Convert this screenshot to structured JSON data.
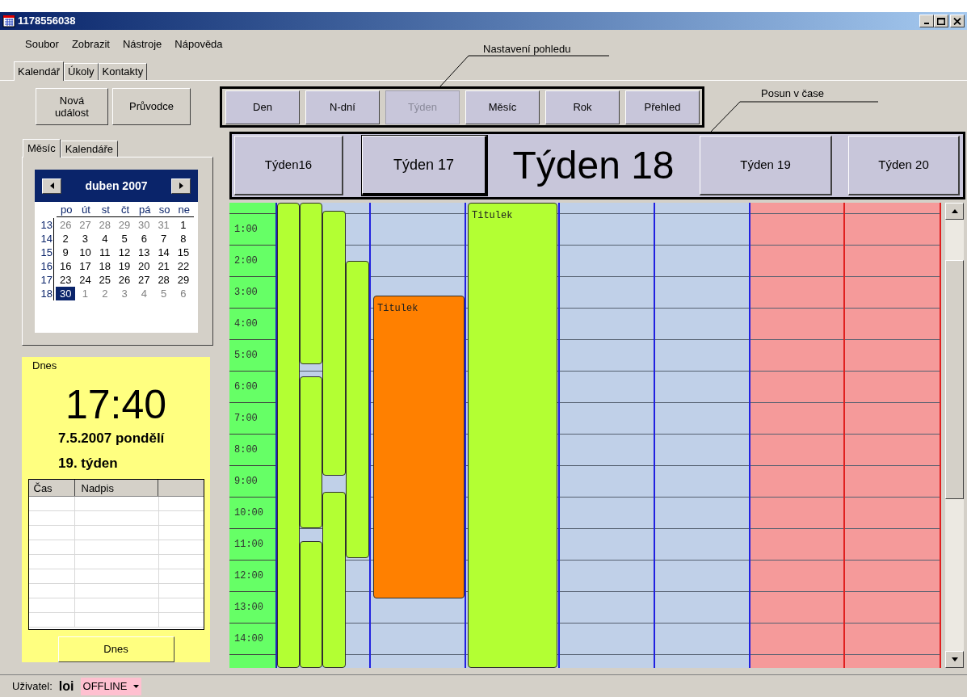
{
  "window": {
    "title": "1178556038"
  },
  "menu": [
    "Soubor",
    "Zobrazit",
    "Nástroje",
    "Nápověda"
  ],
  "tabs": [
    {
      "label": "Kalendář",
      "selected": true
    },
    {
      "label": "Úkoly",
      "selected": false
    },
    {
      "label": "Kontakty",
      "selected": false
    }
  ],
  "actions": [
    "Nová událost",
    "Průvodce"
  ],
  "subtabs": [
    {
      "label": "Měsíc",
      "selected": true
    },
    {
      "label": "Kalendáře",
      "selected": false
    }
  ],
  "mini_calendar": {
    "month": "duben 2007",
    "weekdays": [
      "po",
      "út",
      "st",
      "čt",
      "pá",
      "so",
      "ne"
    ],
    "weeks": [
      {
        "week": "13",
        "days": [
          {
            "label": "26",
            "muted": true,
            "selected": false
          },
          {
            "label": "27",
            "muted": true,
            "selected": false
          },
          {
            "label": "28",
            "muted": true,
            "selected": false
          },
          {
            "label": "29",
            "muted": true,
            "selected": false
          },
          {
            "label": "30",
            "muted": true,
            "selected": false
          },
          {
            "label": "31",
            "muted": true,
            "selected": false
          },
          {
            "label": "1",
            "muted": false,
            "selected": false
          }
        ]
      },
      {
        "week": "14",
        "days": [
          {
            "label": "2",
            "muted": false,
            "selected": false
          },
          {
            "label": "3",
            "muted": false,
            "selected": false
          },
          {
            "label": "4",
            "muted": false,
            "selected": false
          },
          {
            "label": "5",
            "muted": false,
            "selected": false
          },
          {
            "label": "6",
            "muted": false,
            "selected": false
          },
          {
            "label": "7",
            "muted": false,
            "selected": false
          },
          {
            "label": "8",
            "muted": false,
            "selected": false
          }
        ]
      },
      {
        "week": "15",
        "days": [
          {
            "label": "9",
            "muted": false,
            "selected": false
          },
          {
            "label": "10",
            "muted": false,
            "selected": false
          },
          {
            "label": "11",
            "muted": false,
            "selected": false
          },
          {
            "label": "12",
            "muted": false,
            "selected": false
          },
          {
            "label": "13",
            "muted": false,
            "selected": false
          },
          {
            "label": "14",
            "muted": false,
            "selected": false
          },
          {
            "label": "15",
            "muted": false,
            "selected": false
          }
        ]
      },
      {
        "week": "16",
        "days": [
          {
            "label": "16",
            "muted": false,
            "selected": false
          },
          {
            "label": "17",
            "muted": false,
            "selected": false
          },
          {
            "label": "18",
            "muted": false,
            "selected": false
          },
          {
            "label": "19",
            "muted": false,
            "selected": false
          },
          {
            "label": "20",
            "muted": false,
            "selected": false
          },
          {
            "label": "21",
            "muted": false,
            "selected": false
          },
          {
            "label": "22",
            "muted": false,
            "selected": false
          }
        ]
      },
      {
        "week": "17",
        "days": [
          {
            "label": "23",
            "muted": false,
            "selected": false
          },
          {
            "label": "24",
            "muted": false,
            "selected": false
          },
          {
            "label": "25",
            "muted": false,
            "selected": false
          },
          {
            "label": "26",
            "muted": false,
            "selected": false
          },
          {
            "label": "27",
            "muted": false,
            "selected": false
          },
          {
            "label": "28",
            "muted": false,
            "selected": false
          },
          {
            "label": "29",
            "muted": false,
            "selected": false
          }
        ]
      },
      {
        "week": "18",
        "days": [
          {
            "label": "30",
            "muted": false,
            "selected": true
          },
          {
            "label": "1",
            "muted": true,
            "selected": false
          },
          {
            "label": "2",
            "muted": true,
            "selected": false
          },
          {
            "label": "3",
            "muted": true,
            "selected": false
          },
          {
            "label": "4",
            "muted": true,
            "selected": false
          },
          {
            "label": "5",
            "muted": true,
            "selected": false
          },
          {
            "label": "6",
            "muted": true,
            "selected": false
          }
        ]
      }
    ]
  },
  "today_panel": {
    "title": "Dnes",
    "time": "17:40",
    "date": "7.5.2007 pondělí",
    "week": "19. týden",
    "columns": [
      "Čas",
      "Nadpis"
    ],
    "button": "Dnes"
  },
  "view_annotation": "Nastavení pohledu",
  "views": [
    {
      "label": "Den",
      "selected": false
    },
    {
      "label": "N-dní",
      "selected": false
    },
    {
      "label": "Týden",
      "selected": true
    },
    {
      "label": "Měsíc",
      "selected": false
    },
    {
      "label": "Rok",
      "selected": false
    },
    {
      "label": "Přehled",
      "selected": false
    }
  ],
  "time_annotation": "Posun v čase",
  "week_nav": [
    {
      "label": "Týden16",
      "kind": "button",
      "focused": false
    },
    {
      "label": "Týden 17",
      "kind": "button",
      "focused": true
    },
    {
      "label": "Týden 18",
      "kind": "current"
    },
    {
      "label": "Týden 19",
      "kind": "button",
      "focused": false
    },
    {
      "label": "Týden 20",
      "kind": "button",
      "focused": false
    }
  ],
  "schedule": {
    "hours": [
      "1:00",
      "2:00",
      "3:00",
      "4:00",
      "5:00",
      "6:00",
      "7:00",
      "8:00",
      "9:00",
      "10:00",
      "11:00",
      "12:00",
      "13:00",
      "14:00"
    ],
    "days": [
      {
        "weekend": false,
        "events": [
          {
            "color": "#b3ff33"
          },
          {
            "color": "#b3ff33"
          },
          {
            "color": "#b3ff33"
          },
          {
            "color": "#b3ff33"
          },
          {
            "color": "#b3ff33"
          },
          {
            "color": "#b3ff33"
          },
          {
            "color": "#b3ff33"
          }
        ]
      },
      {
        "weekend": false,
        "events": [
          {
            "color": "#ff8000",
            "title": "Titulek"
          }
        ]
      },
      {
        "weekend": false,
        "events": [
          {
            "color": "#b3ff33",
            "title": "Titulek"
          }
        ]
      },
      {
        "weekend": false
      },
      {
        "weekend": false
      },
      {
        "weekend": true
      },
      {
        "weekend": true
      }
    ]
  },
  "status_bar": {
    "label": "Uživatel:",
    "user": "loi",
    "status": "OFFLINE"
  }
}
